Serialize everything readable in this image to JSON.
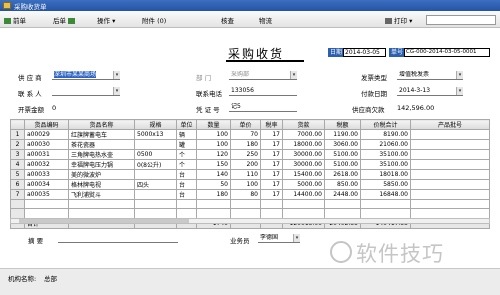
{
  "window": {
    "title": "采购收货单"
  },
  "toolbar": {
    "prev": "前单",
    "next": "后单",
    "ops": "操作",
    "attach": "附件 (0)",
    "audit": "核查",
    "logistics": "物流",
    "print": "打印"
  },
  "header": {
    "title": "采购收货",
    "date_label": "日期",
    "date_value": "2014-03-05",
    "no_label": "单号",
    "no_value": "CG-000-2014-03-05-0001"
  },
  "fields": {
    "supplier_label": "供 应 商",
    "supplier_value": "深圳市某某商场",
    "dept_label": "部    门",
    "dept_value": "采购部",
    "contact_label": "联 系 人",
    "phone_label": "联系电话",
    "phone_value": "133056",
    "payable_label": "开票金额",
    "payable_value": "0",
    "voucher_label": "凭 证 号",
    "voucher_value": "记5",
    "type_label": "发票类型",
    "type_value": "增值税发票",
    "paydate_label": "付款日期",
    "paydate_value": "2014-3-13",
    "owed_label": "供应商欠款",
    "owed_value": "142,596.00",
    "remark_label": "摘    要",
    "clerk_label": "业务员",
    "clerk_value": "李德国"
  },
  "table": {
    "columns": [
      "",
      "货品编码",
      "货品名称",
      "规格",
      "单位",
      "数量",
      "单价",
      "税率",
      "货款",
      "税额",
      "价税合计",
      "产品批号"
    ],
    "rows": [
      [
        "1",
        "a00029",
        "红旗牌蓄电车",
        "5000x13",
        "辆",
        "100",
        "70",
        "17",
        "7000.00",
        "1190.00",
        "8190.00",
        ""
      ],
      [
        "2",
        "a00030",
        "茶花瓷器",
        "",
        "罐",
        "100",
        "180",
        "17",
        "18000.00",
        "3060.00",
        "21060.00",
        ""
      ],
      [
        "3",
        "a00031",
        "三角牌电热水壶",
        "0500",
        "个",
        "120",
        "250",
        "17",
        "30000.00",
        "5100.00",
        "35100.00",
        ""
      ],
      [
        "4",
        "a00032",
        "幸福牌电压力锅",
        "0(8公升)",
        "个",
        "150",
        "200",
        "17",
        "30000.00",
        "5100.00",
        "35100.00",
        ""
      ],
      [
        "5",
        "a00033",
        "美的微波炉",
        "",
        "台",
        "140",
        "110",
        "17",
        "15400.00",
        "2618.00",
        "18018.00",
        ""
      ],
      [
        "6",
        "a00034",
        "格林牌电视",
        "四头",
        "台",
        "50",
        "100",
        "17",
        "5000.00",
        "850.00",
        "5850.00",
        ""
      ],
      [
        "7",
        "a00035",
        "飞利浦熨斗",
        "",
        "台",
        "180",
        "80",
        "17",
        "14400.00",
        "2448.00",
        "16848.00",
        ""
      ],
      [
        "",
        "",
        "",
        "",
        "",
        "",
        "",
        "",
        "",
        "",
        "",
        ""
      ],
      [
        "",
        "",
        "",
        "",
        "",
        "",
        "",
        "",
        "",
        "",
        "",
        ""
      ]
    ],
    "sum": {
      "label": "合计",
      "qty": "1740",
      "amount": "120015.00",
      "tax": "20402.55",
      "total": "140417.55"
    }
  },
  "status": {
    "operator_label": "机构名称:",
    "operator_value": "总部"
  },
  "watermark": "软件技巧",
  "colors": {
    "titlebar": "#2453a6",
    "highlight": "#2f64c4"
  }
}
